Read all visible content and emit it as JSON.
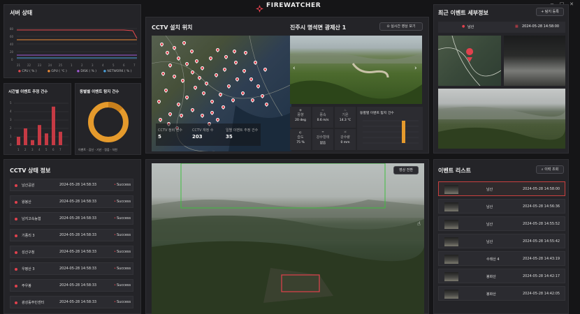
{
  "app": {
    "title": "FIREWATCHER",
    "window_controls": [
      "−",
      "□",
      "✕"
    ]
  },
  "server": {
    "title": "서버 상태",
    "yticks": [
      "80",
      "60",
      "40",
      "20",
      "0"
    ],
    "xticks": [
      "21",
      "22",
      "23",
      "24",
      "25",
      "1",
      "2",
      "3",
      "4",
      "5",
      "6",
      "7"
    ],
    "legend": [
      "CPU ( % )",
      "GPU ( ℃ )",
      "DISK ( % )",
      "NETWORK ( % )"
    ],
    "colors": {
      "cpu": "#e5484d",
      "gpu": "#f08c36",
      "disk": "#a25ad6",
      "network": "#4aa3df"
    }
  },
  "hourly": {
    "title": "시간별 이벤트 추정 건수",
    "yticks": [
      "5",
      "4",
      "3",
      "2",
      "1",
      "0"
    ],
    "xticks": [
      "1",
      "2",
      "3",
      "4",
      "5",
      "6",
      "7"
    ],
    "values": [
      1,
      2,
      0.6,
      2.4,
      1.4,
      4.6,
      1.6
    ]
  },
  "regional": {
    "title": "동별별 이벤트 탐지 건수",
    "legend": [
      "이벤트",
      "감신",
      "기산",
      "정읍",
      "석천"
    ],
    "colors": [
      "#e59a2c",
      "#d48a1f"
    ]
  },
  "map": {
    "title": "CCTV 설치 위치",
    "stats": [
      {
        "label": "CCTV 정비 건수",
        "value": "5"
      },
      {
        "label": "CCTV 재정 수",
        "value": "203"
      },
      {
        "label": "일별 이벤트 추정 건수",
        "value": "35"
      }
    ]
  },
  "camera": {
    "title": "진주시 명석면 광제산 1",
    "live_button": "실시간 영상 보기",
    "weather": [
      {
        "label": "풍향",
        "value": "20 deg"
      },
      {
        "label": "풍속",
        "value": "0.6 m/s"
      },
      {
        "label": "기온",
        "value": "14.3 ℃"
      },
      {
        "label": "습도",
        "value": "75 %"
      },
      {
        "label": "강수형태",
        "value": "없음"
      },
      {
        "label": "강수량",
        "value": "0 mm"
      }
    ],
    "weekly_title": "동별별 이벤트 탐지 건수"
  },
  "recent": {
    "title": "최근 이벤트 세부정보",
    "detail_button": "+ 탐지 등록",
    "location": "남산",
    "datetime": "2024-05-28 14:58:00"
  },
  "cctv_status": {
    "title": "CCTV 상태 정보",
    "rows": [
      {
        "name": "남산공원",
        "time": "2024-05-28 14:58:33",
        "status": "Success"
      },
      {
        "name": "왕봉산",
        "time": "2024-05-28 14:58:33",
        "status": "Success"
      },
      {
        "name": "남지고속농협",
        "time": "2024-05-28 14:58:33",
        "status": "Success"
      },
      {
        "name": "기종리 3",
        "time": "2024-05-28 14:58:33",
        "status": "Success"
      },
      {
        "name": "성산구청",
        "time": "2024-05-28 14:58:33",
        "status": "Success"
      },
      {
        "name": "우평산 3",
        "time": "2024-05-28 14:58:33",
        "status": "Success"
      },
      {
        "name": "주우봉",
        "time": "2024-05-28 14:58:33",
        "status": "Success"
      },
      {
        "name": "광성동주민센터",
        "time": "2024-05-28 14:58:33",
        "status": "Success"
      }
    ]
  },
  "main_video": {
    "fullscreen_button": "영상 전환"
  },
  "event_list": {
    "title": "이벤트 리스트",
    "history_button": "이력 조회",
    "rows": [
      {
        "location": "남산",
        "time": "2024-05-28 14:58:00"
      },
      {
        "location": "남산",
        "time": "2024-05-28 14:56:36"
      },
      {
        "location": "남산",
        "time": "2024-05-28 14:55:52"
      },
      {
        "location": "남산",
        "time": "2024-05-28 14:55:42"
      },
      {
        "location": "수태산 4",
        "time": "2024-05-28 14:43:19"
      },
      {
        "location": "봉화산",
        "time": "2024-05-28 14:42:17"
      },
      {
        "location": "봉화산",
        "time": "2024-05-28 14:42:05"
      }
    ]
  }
}
